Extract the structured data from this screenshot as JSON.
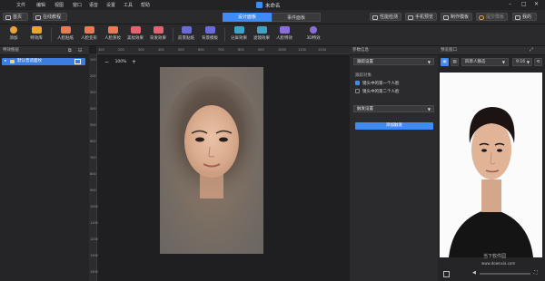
{
  "window": {
    "title": "未命名",
    "menu": [
      "文件",
      "编辑",
      "视图",
      "窗口",
      "语音",
      "设置",
      "工具",
      "帮助"
    ]
  },
  "nav": {
    "home": "首页",
    "tutorial": "在线教程",
    "tabs": [
      {
        "label": "设计面板",
        "active": true
      },
      {
        "label": "事件面板",
        "active": false
      }
    ],
    "right_buttons": [
      "性能检测",
      "手机预览",
      "制作模板",
      "提交模板",
      "我的"
    ]
  },
  "toolbar": {
    "tools": [
      {
        "label": "添加",
        "color": "#e8a437"
      },
      {
        "label": "特效库",
        "color": "#e8a437"
      },
      {
        "label": "人脸贴纸",
        "color": "#e77b52"
      },
      {
        "label": "人脸变形",
        "color": "#e77b52"
      },
      {
        "label": "人脸蒸妆",
        "color": "#e77b52"
      },
      {
        "label": "美妆效果",
        "color": "#e26470"
      },
      {
        "label": "染发效果",
        "color": "#e26470"
      },
      {
        "label": "前景贴纸",
        "color": "#6a6ad8"
      },
      {
        "label": "背景模板",
        "color": "#6a6ad8"
      },
      {
        "label": "分屏效果",
        "color": "#3fa3c7"
      },
      {
        "label": "滤镜效果",
        "color": "#3fa3c7"
      },
      {
        "label": "人脸特效",
        "color": "#8a6fd8"
      },
      {
        "label": "3D特效",
        "color": "#8a6fd8"
      }
    ]
  },
  "left_panel": {
    "header": "特效图层",
    "layer": "默认普适面纹"
  },
  "canvas": {
    "zoom": "100%",
    "ruler_h": [
      "100",
      "200",
      "300",
      "400",
      "500",
      "600",
      "700",
      "800",
      "900",
      "1000",
      "1100",
      "1200"
    ],
    "ruler_v": [
      "100",
      "200",
      "300",
      "400",
      "500",
      "600",
      "700",
      "800",
      "900",
      "1000",
      "1100",
      "1200",
      "1300",
      "1400"
    ]
  },
  "settings": {
    "header": "参数信息",
    "section1": "跟踪设置",
    "track_label": "跟踪对象",
    "options": [
      {
        "label": "镜头中的第一个人脸",
        "checked": true
      },
      {
        "label": "镜头中的第二个人脸",
        "checked": false
      }
    ],
    "section2": "触发设置",
    "add_button": "添加触发"
  },
  "preview": {
    "header": "预览窗口",
    "dropdown": "四草人静态",
    "ratio": "9:16",
    "watermark": "www.downxia.com",
    "watermark2": "当下软件园"
  },
  "colors": {
    "accent": "#3f8bf5"
  }
}
